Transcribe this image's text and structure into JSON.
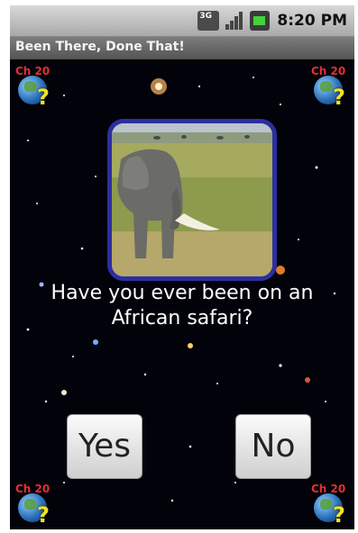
{
  "status_bar": {
    "network_icon_text": "3G",
    "time": "8:20 PM"
  },
  "app": {
    "title": "Been There, Done That!"
  },
  "corner_badge": {
    "chapter_label": "Ch 20",
    "mark": "?"
  },
  "content": {
    "question": "Have you ever been on an African safari?",
    "yes_label": "Yes",
    "no_label": "No"
  },
  "colors": {
    "frame_border": "#2b2fa0",
    "title_bar": "#6a6a6a",
    "background": "#02020a"
  }
}
